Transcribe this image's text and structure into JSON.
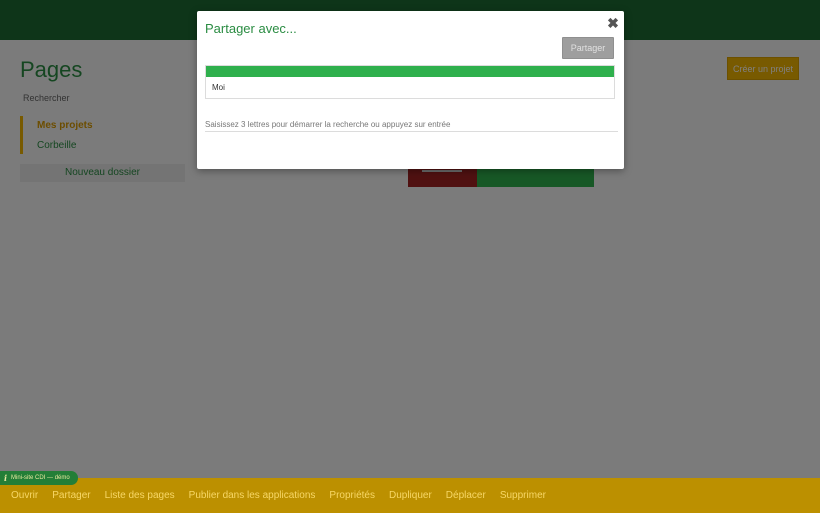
{
  "page": {
    "title": "Pages",
    "search_label": "Rechercher",
    "nav": [
      {
        "label": "Mes projets",
        "active": true
      },
      {
        "label": "Corbeille",
        "active": false
      }
    ],
    "new_folder_label": "Nouveau dossier",
    "create_project_label": "Créer un projet"
  },
  "modal": {
    "title": "Partager avec...",
    "share_button_label": "Partager",
    "close_icon": "✖",
    "share_rows": [
      {
        "name": "Moi"
      }
    ],
    "search_placeholder": "Saisissez 3 lettres pour démarrer la recherche ou appuyez sur entrée"
  },
  "env_badge": {
    "icon": "i",
    "label": "Mini-site CDI — démo"
  },
  "bottom_bar": {
    "actions": [
      "Ouvrir",
      "Partager",
      "Liste des pages",
      "Publier dans les applications",
      "Propriétés",
      "Dupliquer",
      "Déplacer",
      "Supprimer"
    ]
  },
  "colors": {
    "brand_green": "#2a8c42",
    "topbar_green": "#1c6b32",
    "accent_yellow": "#f0b400",
    "table_header_green": "#2fb04d"
  }
}
